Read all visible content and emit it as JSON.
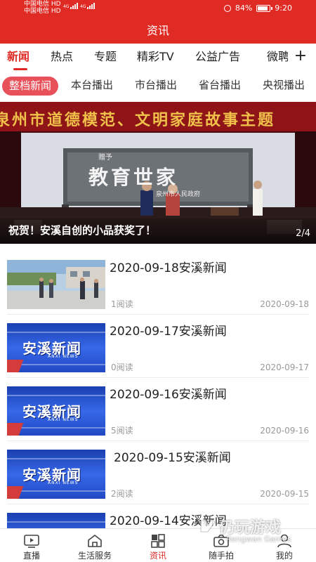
{
  "status_bar": {
    "carrier_1": "中国电信",
    "carrier_2": "中国电信",
    "badge": "HD",
    "network": "4G",
    "battery": "84%",
    "battery_level": 0.84,
    "time": "9:20"
  },
  "header": {
    "title": "资讯"
  },
  "tabs": [
    {
      "label": "新闻",
      "active": true
    },
    {
      "label": "热点"
    },
    {
      "label": "专题"
    },
    {
      "label": "精彩TV"
    },
    {
      "label": "公益广告"
    },
    {
      "label": "微聘"
    }
  ],
  "tabs_more_icon": "plus-icon",
  "subtabs": [
    {
      "label": "整档新闻",
      "active": true
    },
    {
      "label": "本台播出"
    },
    {
      "label": "市台播出"
    },
    {
      "label": "省台播出"
    },
    {
      "label": "央视播出"
    }
  ],
  "banner": {
    "headline": "泉州市道德模范、文明家庭故事主题",
    "plaque_small": "赠予",
    "plaque_text": "教育世家",
    "plaque_sign": "泉州市人民政府",
    "caption": "祝贺！安溪自创的小品获奖了！",
    "counter": "2/4"
  },
  "news": [
    {
      "title": "2020-09-18安溪新闻",
      "reads": "1阅读",
      "date": "2020-09-18",
      "thumb": "photo"
    },
    {
      "title": "2020-09-17安溪新闻",
      "reads": "0阅读",
      "date": "2020-09-17",
      "thumb": "logo"
    },
    {
      "title": "2020-09-16安溪新闻",
      "reads": "5阅读",
      "date": "2020-09-16",
      "thumb": "logo"
    },
    {
      "title": "2020-09-15安溪新闻",
      "reads": "2阅读",
      "date": "2020-09-15",
      "thumb": "logo"
    },
    {
      "title": "2020-09-14安溪新闻",
      "reads": "",
      "date": "",
      "thumb": "logo"
    }
  ],
  "news_logo": {
    "text": "安溪新闻",
    "sub": "ANXI NEWS"
  },
  "bottom_nav": [
    {
      "label": "直播",
      "icon": "tv-icon"
    },
    {
      "label": "生活服务",
      "icon": "home-icon"
    },
    {
      "label": "资讯",
      "icon": "grid-icon",
      "active": true
    },
    {
      "label": "随手拍",
      "icon": "camera-icon"
    },
    {
      "label": "我的",
      "icon": "user-icon"
    }
  ],
  "watermark": {
    "text": "仍玩游戏",
    "sub": "Rengwan Games"
  },
  "colors": {
    "brand_red": "#e02a24",
    "chip_red": "#e8505a",
    "news_blue": "#2a55d6"
  }
}
